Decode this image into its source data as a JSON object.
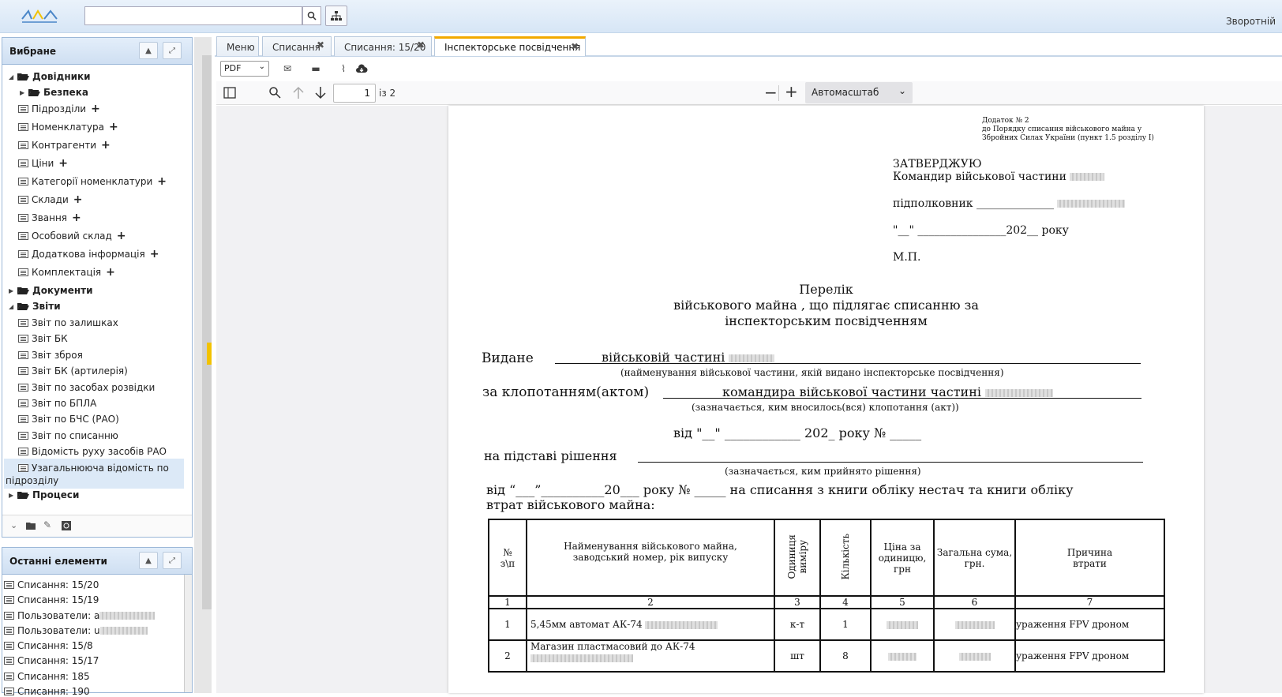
{
  "header": {
    "search_placeholder": "",
    "feedback_label": "Зворотній"
  },
  "favorites": {
    "title": "Вибране",
    "items": [
      {
        "label": "Довідники"
      },
      {
        "label": "Безпека"
      },
      {
        "label": "Підрозділи"
      },
      {
        "label": "Номенклатура"
      },
      {
        "label": "Контрагенти"
      },
      {
        "label": "Ціни"
      },
      {
        "label": "Категорії номенклатури"
      },
      {
        "label": "Склади"
      },
      {
        "label": "Звання"
      },
      {
        "label": "Особовий склад"
      },
      {
        "label": "Додаткова інформація"
      },
      {
        "label": "Комплектація"
      },
      {
        "label": "Документи"
      },
      {
        "label": "Звіти"
      },
      {
        "label": "Звіт по залишках"
      },
      {
        "label": "Звіт БК"
      },
      {
        "label": "Звіт зброя"
      },
      {
        "label": "Звіт БК (артилерія)"
      },
      {
        "label": "Звіт по засобах розвідки"
      },
      {
        "label": "Звіт по БПЛА"
      },
      {
        "label": "Звіт по БЧС (РАО)"
      },
      {
        "label": "Звіт по списанню"
      },
      {
        "label": "Відомість руху засобів РАО"
      },
      {
        "label": "Узагальнююча відомість по"
      },
      {
        "label": "підрозділу"
      },
      {
        "label": "Процеси"
      }
    ]
  },
  "recent": {
    "title": "Останні елементи",
    "items": [
      {
        "label": "Списання: 15/20"
      },
      {
        "label": "Списання: 15/19"
      },
      {
        "label": "Пользователи: a"
      },
      {
        "label": "Пользователи: u"
      },
      {
        "label": "Списання: 15/8"
      },
      {
        "label": "Списання: 15/17"
      },
      {
        "label": "Списання: 185"
      },
      {
        "label": "Списання: 190"
      }
    ]
  },
  "tabs": [
    {
      "label": "Меню"
    },
    {
      "label": "Списання"
    },
    {
      "label": "Списання: 15/20"
    },
    {
      "label": "Інспекторське посвідчення"
    }
  ],
  "toolbar": {
    "format": "PDF"
  },
  "viewer": {
    "page_current": "1",
    "page_total": "із 2",
    "zoom": "Автомасштаб"
  },
  "document": {
    "annex_1": "Додаток № 2",
    "annex_2": "до Порядку списання військового майна у",
    "annex_3": "Збройних Силах України (пункт 1.5 розділу I)",
    "approve": "ЗАТВЕРДЖУЮ",
    "commander": "Командир військової частини",
    "rank": "підполковник ______________",
    "date_line": "\"__\" ________________202__ року",
    "mp": "М.П.",
    "title_1": "Перелік",
    "title_2": "військового майна , що підлягає списанню за",
    "title_3": "інспекторським посвідченням",
    "issued_label": "Видане",
    "issued_value": "військовій частині",
    "issued_hint": "(найменування військової частини, якій видано інспекторське посвідчення)",
    "petition_label": "за клопотанням(актом)",
    "petition_value": "командира військової частини частині",
    "petition_hint": "(зазначається, ким вносилось(вся) клопотання (акт))",
    "from_line": "від \"__\" ____________ 202_ року № _____",
    "decision_label": "на підставі рішення",
    "decision_hint": "(зазначається, ким прийнято рішення)",
    "writeoff_1": "від “___”__________20___ року  № _____ на списання з книги обліку нестач та книги обліку",
    "writeoff_2": "втрат військового майна:",
    "table": {
      "headers": [
        "№\nз\\п",
        "Найменування військового майна,\nзаводський номер, рік випуску",
        "Одиниця\nвиміру",
        "Кількість",
        "Ціна за\nодиницю,\nгрн",
        "Загальна сума,\nгрн.",
        "Причина\nвтрати"
      ],
      "nums": [
        "1",
        "2",
        "3",
        "4",
        "5",
        "6",
        "7"
      ],
      "rows": [
        {
          "n": "1",
          "name": "5,45мм автомат АК-74",
          "unit": "к-т",
          "qty": "1",
          "reason": "ураження FPV дроном"
        },
        {
          "n": "2",
          "name": "Магазин пластмасовий до АК-74",
          "unit": "шт",
          "qty": "8",
          "reason": "ураження FPV дроном"
        }
      ]
    }
  },
  "colors": {
    "accent": "#f2a900",
    "panel_header": "#cfdff2"
  }
}
